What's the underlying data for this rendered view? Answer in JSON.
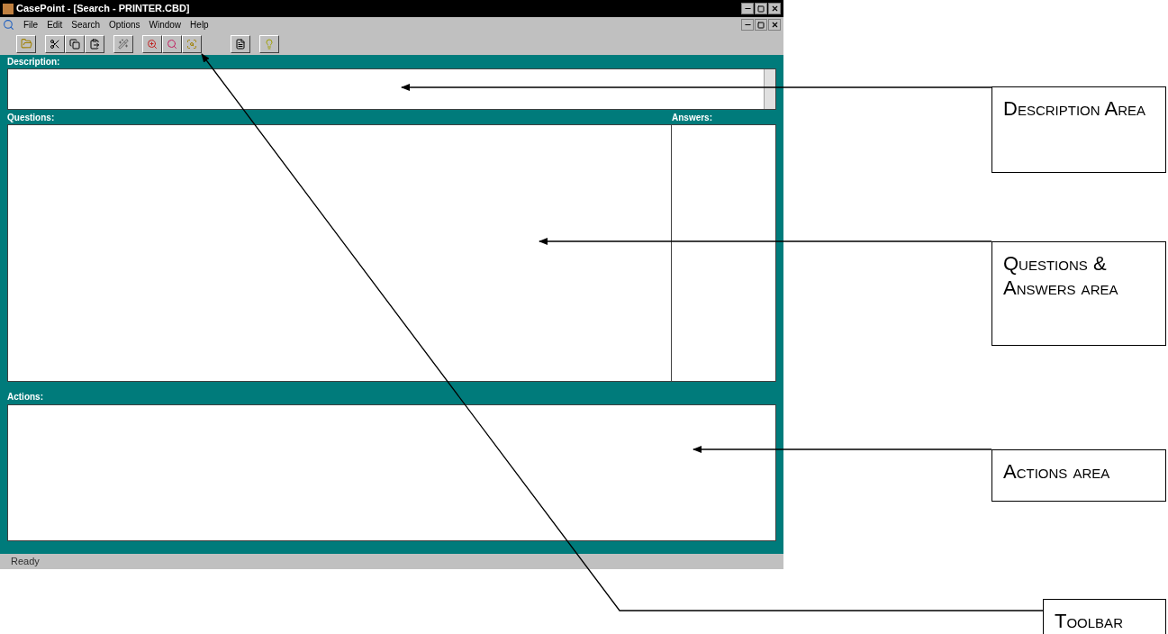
{
  "window": {
    "title": "CasePoint - [Search - PRINTER.CBD]"
  },
  "menu": [
    "File",
    "Edit",
    "Search",
    "Options",
    "Window",
    "Help"
  ],
  "description": {
    "label": "Description:"
  },
  "questions": {
    "label": "Questions:"
  },
  "answers": {
    "label": "Answers:"
  },
  "actions": {
    "label": "Actions:"
  },
  "status_bar": "Ready",
  "callouts": [
    {
      "kind": "description",
      "text": "Description Area"
    },
    {
      "kind": "qa",
      "text": "Questions & Answers area"
    },
    {
      "kind": "actions",
      "text": "Actions area"
    },
    {
      "kind": "toolbar",
      "text": "Toolbar"
    }
  ]
}
